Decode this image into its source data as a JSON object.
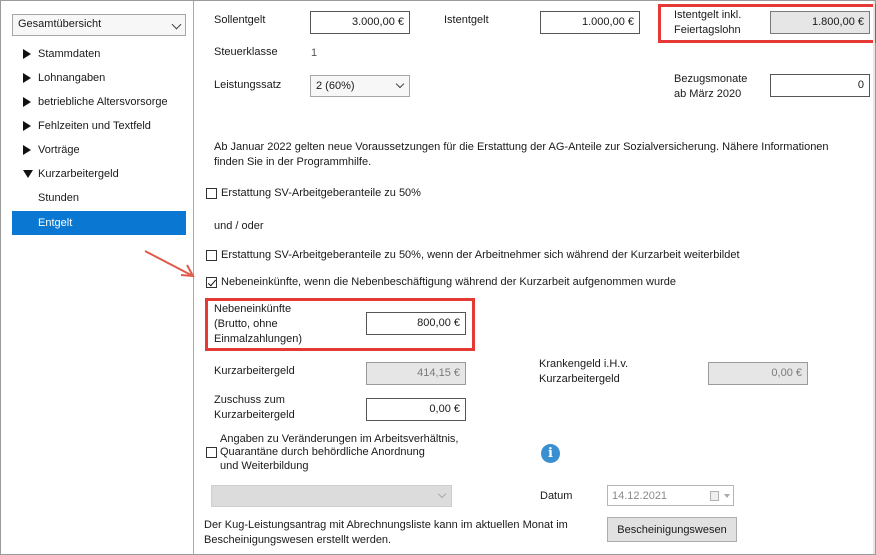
{
  "sidebar": {
    "overview_select": "Gesamtübersicht",
    "items": [
      {
        "label": "Stammdaten",
        "expanded": false
      },
      {
        "label": "Lohnangaben",
        "expanded": false
      },
      {
        "label": "betriebliche Altersvorsorge",
        "expanded": false
      },
      {
        "label": "Fehlzeiten und Textfeld",
        "expanded": false
      },
      {
        "label": "Vorträge",
        "expanded": false
      },
      {
        "label": "Kurzarbeitergeld",
        "expanded": true
      }
    ],
    "subitems": [
      {
        "label": "Stunden",
        "active": false
      },
      {
        "label": "Entgelt",
        "active": true
      }
    ]
  },
  "form": {
    "sollentgelt_label": "Sollentgelt",
    "sollentgelt_value": "3.000,00 €",
    "istentgelt_label": "Istentgelt",
    "istentgelt_value": "1.000,00 €",
    "istentgelt_feiertag_label_1": "Istentgelt inkl.",
    "istentgelt_feiertag_label_2": "Feiertagslohn",
    "istentgelt_feiertag_value": "1.800,00 €",
    "steuerklasse_label": "Steuerklasse",
    "steuerklasse_value": "1",
    "leistungssatz_label": "Leistungssatz",
    "leistungssatz_value": "2 (60%)",
    "bezugsmonate_label_1": "Bezugsmonate",
    "bezugsmonate_label_2": "ab März 2020",
    "bezugsmonate_value": "0",
    "info_line_1": "Ab Januar 2022 gelten neue Voraussetzungen für die Erstattung der AG-Anteile zur Sozialversicherung. Nähere Informationen",
    "info_line_2": "finden Sie in der Programmhilfe.",
    "check_erstattung_50": {
      "label": "Erstattung SV-Arbeitgeberanteile zu 50%",
      "checked": false
    },
    "und_oder": "und / oder",
    "check_erstattung_weiterbildung": {
      "label": "Erstattung SV-Arbeitgeberanteile zu 50%, wenn der Arbeitnehmer sich während der Kurzarbeit weiterbildet",
      "checked": false
    },
    "check_nebeneinkuenfte": {
      "label": "Nebeneinkünfte, wenn die Nebenbeschäftigung während der Kurzarbeit aufgenommen wurde",
      "checked": true
    },
    "nebeneinkuenfte_label_1": "Nebeneinkünfte",
    "nebeneinkuenfte_label_2": "(Brutto, ohne",
    "nebeneinkuenfte_label_3": "Einmalzahlungen)",
    "nebeneinkuenfte_value": "800,00 €",
    "kurzarbeitergeld_label": "Kurzarbeitergeld",
    "kurzarbeitergeld_value": "414,15 €",
    "krankengeld_label_1": "Krankengeld  i.H.v.",
    "krankengeld_label_2": "Kurzarbeitergeld",
    "krankengeld_value": "0,00 €",
    "zuschuss_label_1": "Zuschuss  zum",
    "zuschuss_label_2": "Kurzarbeitergeld",
    "zuschuss_value": "0,00 €",
    "check_veraenderungen": {
      "label_1": "Angaben zu Veränderungen im Arbeitsverhältnis,",
      "label_2": "Quarantäne durch behördliche Anordnung",
      "label_3": "und Weiterbildung",
      "checked": false
    },
    "disabled_select_value": "",
    "datum_label": "Datum",
    "datum_value": "14.12.2021",
    "footer_line_1": "Der Kug-Leistungsantrag mit Abrechnungsliste kann im aktuellen Monat im",
    "footer_line_2": "Bescheinigungswesen erstellt werden.",
    "bescheinigungswesen_button": "Bescheinigungswesen"
  },
  "colors": {
    "highlight_red": "#e53935",
    "arrow_red": "#e05a4a",
    "active_nav": "#0a78d2",
    "info_icon": "#3a8fd0"
  }
}
